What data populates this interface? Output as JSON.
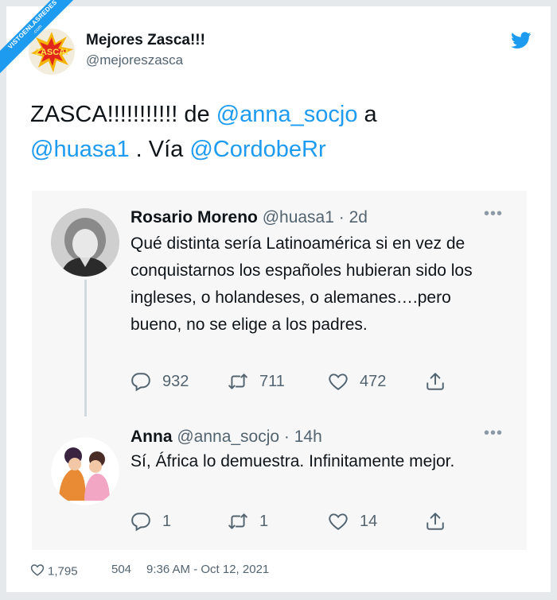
{
  "watermark": {
    "line1": "VISTOENLASREDES",
    "line2": ".com"
  },
  "author": {
    "display_name": "Mejores Zasca!!!",
    "handle": "@mejoreszasca",
    "avatar_text": "ZASCA!"
  },
  "tweet": {
    "part1": "ZASCA!!!!!!!!!!! de ",
    "mention1": "@anna_socjo",
    "part2": " a ",
    "mention2": "@huasa1",
    "part3": " . Vía ",
    "mention3": "@CordobeRr"
  },
  "replies": [
    {
      "name": "Rosario Moreno",
      "handle": "@huasa1 · 2d",
      "more": "•••",
      "text": "Qué distinta sería Latinoamérica si en vez de conquistarnos los españoles hubieran sido los ingleses, o holandeses, o alemanes….pero bueno, no se elige a los padres.",
      "replies": "932",
      "retweets": "711",
      "likes": "472"
    },
    {
      "name": "Anna",
      "handle": "@anna_socjo · 14h",
      "more": "•••",
      "text": "Sí, África lo demuestra. Infinitamente mejor.",
      "replies": "1",
      "retweets": "1",
      "likes": "14"
    }
  ],
  "footer": {
    "likes": "1,795",
    "retweets": "504",
    "timestamp": "9:36 AM - Oct 12, 2021"
  },
  "colors": {
    "accent": "#1d9bf0",
    "text": "#0f1419",
    "muted": "#536471",
    "card_bg": "#f7f7f7"
  },
  "icons": [
    "twitter-bird-icon",
    "reply-icon",
    "retweet-icon",
    "like-icon",
    "share-icon",
    "more-icon"
  ]
}
